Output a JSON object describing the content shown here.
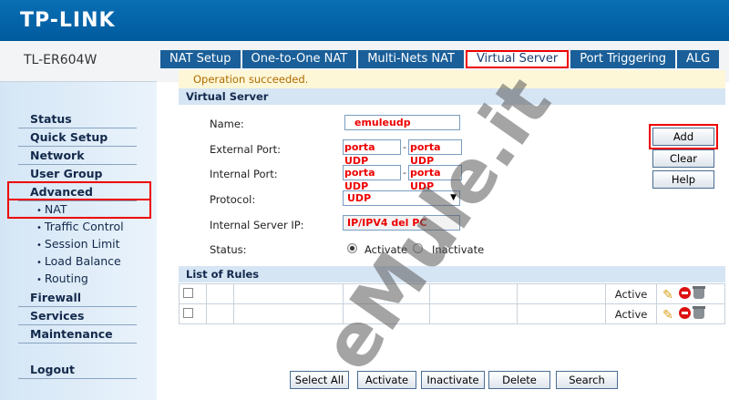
{
  "header": {
    "logo": "TP-LINK",
    "model": "TL-ER604W"
  },
  "tabs": [
    {
      "label": "NAT Setup"
    },
    {
      "label": "One-to-One NAT"
    },
    {
      "label": "Multi-Nets NAT"
    },
    {
      "label": "Virtual Server"
    },
    {
      "label": "Port Triggering"
    },
    {
      "label": "ALG"
    }
  ],
  "sidebar": {
    "items": [
      {
        "label": "Status"
      },
      {
        "label": "Quick Setup"
      },
      {
        "label": "Network"
      },
      {
        "label": "User Group"
      },
      {
        "label": "Advanced"
      },
      {
        "label": "Firewall"
      },
      {
        "label": "Services"
      },
      {
        "label": "Maintenance"
      },
      {
        "label": "Logout"
      }
    ],
    "sub_items": [
      {
        "label": "NAT"
      },
      {
        "label": "Traffic Control"
      },
      {
        "label": "Session Limit"
      },
      {
        "label": "Load Balance"
      },
      {
        "label": "Routing"
      }
    ]
  },
  "content": {
    "status_message": "Operation succeeded.",
    "section_title": "Virtual Server",
    "form": {
      "name_label": "Name:",
      "name_value": "emuleudp",
      "external_port_label": "External Port:",
      "external_port_start": "porta UDP",
      "external_port_end": "porta UDP",
      "internal_port_label": "Internal Port:",
      "internal_port_start": "porta UDP",
      "internal_port_end": "porta UDP",
      "separator": "-",
      "protocol_label": "Protocol:",
      "protocol_value": "UDP",
      "server_ip_label": "Internal Server IP:",
      "server_ip_value": "IP/IPV4 del PC",
      "status_label": "Status:",
      "status_activate": "Activate",
      "status_inactivate": "Inactivate"
    },
    "side_buttons": {
      "add": "Add",
      "clear": "Clear",
      "help": "Help"
    },
    "rules_title": "List of Rules",
    "rules": [
      {
        "status": "Active"
      },
      {
        "status": "Active"
      }
    ],
    "bottom_buttons": {
      "select_all": "Select All",
      "activate": "Activate",
      "inactivate": "Inactivate",
      "delete": "Delete",
      "search": "Search"
    }
  },
  "watermark": "eMule.it",
  "colors": {
    "brand": "#0a6fb3",
    "highlight": "#e00000",
    "sidebar": "#d4e6f6"
  }
}
